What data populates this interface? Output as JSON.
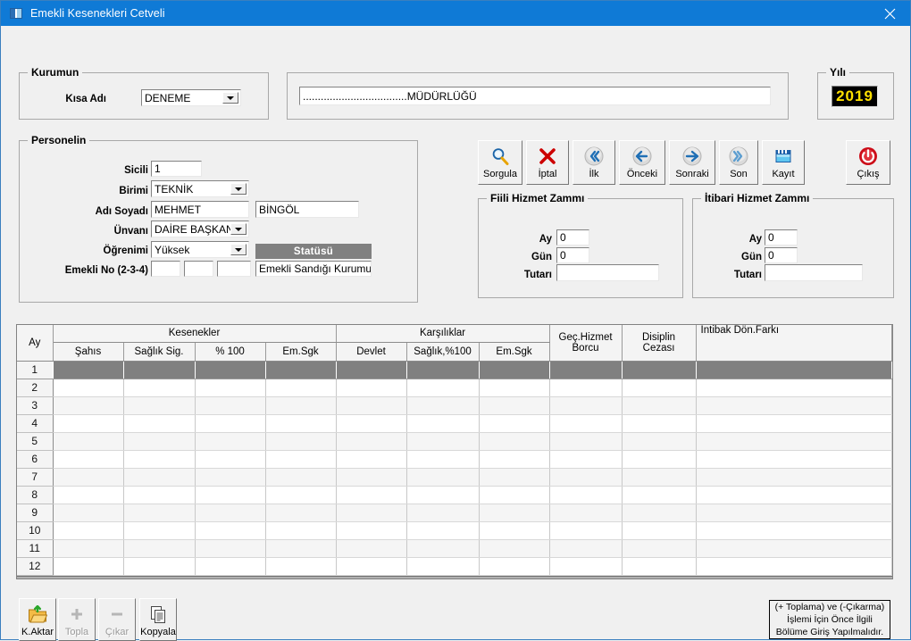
{
  "window": {
    "title": "Emekli Kesenekleri Cetveli",
    "close_label": "✕",
    "titlebar_color": "#0f7ad6"
  },
  "kurumun": {
    "legend": "Kurumun",
    "kisa_adi_label": "Kısa Adı",
    "kisa_adi_value": "DENEME",
    "unvan_value": "...................................MÜDÜRLÜĞÜ"
  },
  "yili": {
    "legend": "Yılı",
    "value": "2019",
    "text_color": "#ffe000",
    "bg_color": "#000000"
  },
  "personelin": {
    "legend": "Personelin",
    "sicili_label": "Sicili",
    "sicili_value": "1",
    "birimi_label": "Birimi",
    "birimi_value": "TEKNİK",
    "adsoyad_label": "Adı Soyadı",
    "ad_value": "MEHMET",
    "soyad_value": "BİNGÖL",
    "unvani_label": "Ünvanı",
    "unvani_value": "DAİRE BAŞKANI",
    "ogrenimi_label": "Öğrenimi",
    "ogrenimi_value": "Yüksek",
    "emekli_no_label": "Emekli No (2-3-4)",
    "emekli_no_1": "",
    "emekli_no_2": "",
    "emekli_no_3": "",
    "statusu_header": "Statüsü",
    "statusu_value": "Emekli Sandığı Kurumu"
  },
  "toolbar": [
    {
      "label": "Sorgula",
      "icon": "search-icon"
    },
    {
      "label": "İptal",
      "icon": "cancel-x-icon"
    },
    {
      "label": "İlk",
      "icon": "first-record-icon"
    },
    {
      "label": "Önceki",
      "icon": "previous-record-icon"
    },
    {
      "label": "Sonraki",
      "icon": "next-record-icon"
    },
    {
      "label": "Son",
      "icon": "last-record-icon"
    },
    {
      "label": "Kayıt",
      "icon": "save-floppy-icon"
    }
  ],
  "exit_button": {
    "label": "Çıkış",
    "icon": "power-icon"
  },
  "fiili": {
    "legend": "Fiili Hizmet Zammı",
    "ay_label": "Ay",
    "ay_value": "0",
    "gun_label": "Gün",
    "gun_value": "0",
    "tutari_label": "Tutarı",
    "tutari_value": ""
  },
  "itibari": {
    "legend": "İtibari Hizmet Zammı",
    "ay_label": "Ay",
    "ay_value": "0",
    "gun_label": "Gün",
    "gun_value": "0",
    "tutari_label": "Tutarı",
    "tutari_value": ""
  },
  "grid": {
    "group_headers": {
      "ay": "Ay",
      "kesenekler": "Kesenekler",
      "karsiliklar": "Karşılıklar",
      "gec_hizmet_borcu": "Geç.Hizmet\nBorcu",
      "gec_hizmet_borcu_l1": "Geç.Hizmet",
      "gec_hizmet_borcu_l2": "Borcu",
      "disiplin_cezasi_l1": "Disiplin",
      "disiplin_cezasi_l2": "Cezası",
      "intibak": "İntibak Dön.Farkı"
    },
    "sub_headers": {
      "kesenekler": [
        "Şahıs",
        "Sağlık Sig.",
        "% 100",
        "Em.Sgk"
      ],
      "karsiliklar": [
        "Devlet",
        "Sağlık,%100",
        "Em.Sgk"
      ]
    },
    "rows": [
      {
        "ay": "1",
        "cells": [
          "",
          "",
          "",
          "",
          "",
          "",
          "",
          "",
          "",
          ""
        ],
        "selected": true
      },
      {
        "ay": "2",
        "cells": [
          "",
          "",
          "",
          "",
          "",
          "",
          "",
          "",
          "",
          ""
        ],
        "selected": false
      },
      {
        "ay": "3",
        "cells": [
          "",
          "",
          "",
          "",
          "",
          "",
          "",
          "",
          "",
          ""
        ],
        "selected": false
      },
      {
        "ay": "4",
        "cells": [
          "",
          "",
          "",
          "",
          "",
          "",
          "",
          "",
          "",
          ""
        ],
        "selected": false
      },
      {
        "ay": "5",
        "cells": [
          "",
          "",
          "",
          "",
          "",
          "",
          "",
          "",
          "",
          ""
        ],
        "selected": false
      },
      {
        "ay": "6",
        "cells": [
          "",
          "",
          "",
          "",
          "",
          "",
          "",
          "",
          "",
          ""
        ],
        "selected": false
      },
      {
        "ay": "7",
        "cells": [
          "",
          "",
          "",
          "",
          "",
          "",
          "",
          "",
          "",
          ""
        ],
        "selected": false
      },
      {
        "ay": "8",
        "cells": [
          "",
          "",
          "",
          "",
          "",
          "",
          "",
          "",
          "",
          ""
        ],
        "selected": false
      },
      {
        "ay": "9",
        "cells": [
          "",
          "",
          "",
          "",
          "",
          "",
          "",
          "",
          "",
          ""
        ],
        "selected": false
      },
      {
        "ay": "10",
        "cells": [
          "",
          "",
          "",
          "",
          "",
          "",
          "",
          "",
          "",
          ""
        ],
        "selected": false
      },
      {
        "ay": "11",
        "cells": [
          "",
          "",
          "",
          "",
          "",
          "",
          "",
          "",
          "",
          ""
        ],
        "selected": false
      },
      {
        "ay": "12",
        "cells": [
          "",
          "",
          "",
          "",
          "",
          "",
          "",
          "",
          "",
          ""
        ],
        "selected": false
      }
    ]
  },
  "bottom_toolbar": [
    {
      "label": "K.Aktar",
      "icon": "folder-export-icon",
      "disabled": false
    },
    {
      "label": "Topla",
      "icon": "plus-icon",
      "disabled": true
    },
    {
      "label": "Çıkar",
      "icon": "minus-icon",
      "disabled": true
    },
    {
      "label": "Kopyala",
      "icon": "copy-icon",
      "disabled": false
    }
  ],
  "note": {
    "line1": "(+ Toplama) ve (-Çıkarma)",
    "line2": "İşlemi İçin Önce İlgili",
    "line3": "Bölüme Giriş Yapılmalıdır."
  }
}
